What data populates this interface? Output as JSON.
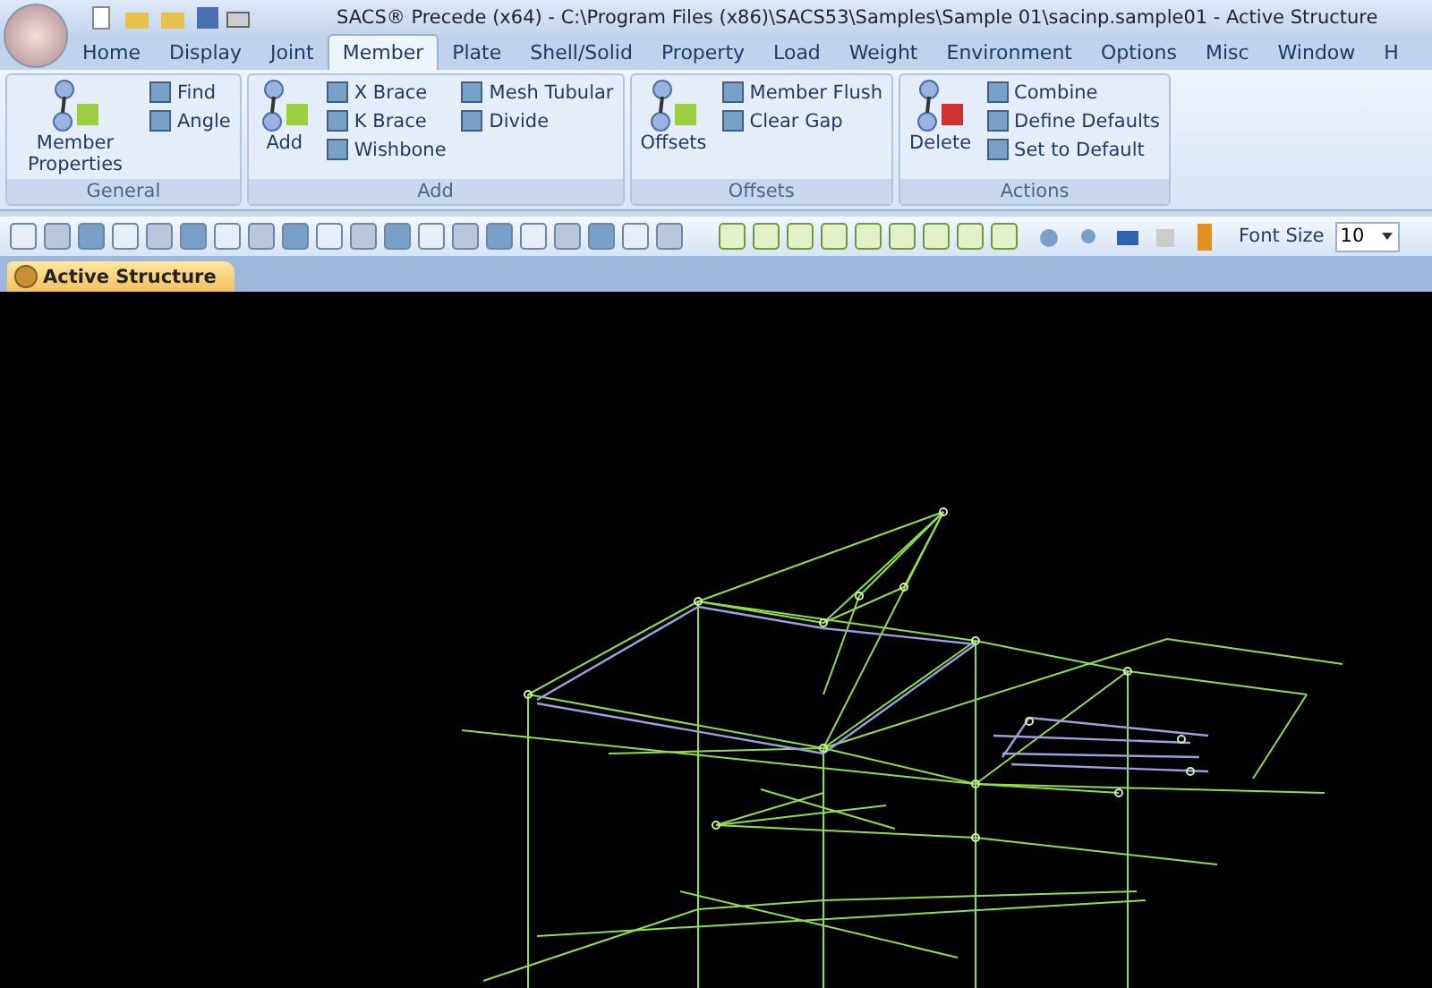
{
  "window": {
    "title": "SACS® Precede (x64) - C:\\Program Files (x86)\\SACS53\\Samples\\Sample 01\\sacinp.sample01 - Active Structure"
  },
  "tabs": [
    {
      "label": "Home",
      "selected": false
    },
    {
      "label": "Display",
      "selected": false
    },
    {
      "label": "Joint",
      "selected": false
    },
    {
      "label": "Member",
      "selected": true
    },
    {
      "label": "Plate",
      "selected": false
    },
    {
      "label": "Shell/Solid",
      "selected": false
    },
    {
      "label": "Property",
      "selected": false
    },
    {
      "label": "Load",
      "selected": false
    },
    {
      "label": "Weight",
      "selected": false
    },
    {
      "label": "Environment",
      "selected": false
    },
    {
      "label": "Options",
      "selected": false
    },
    {
      "label": "Misc",
      "selected": false
    },
    {
      "label": "Window",
      "selected": false
    },
    {
      "label": "H",
      "selected": false
    }
  ],
  "ribbon_groups": [
    {
      "label": "General",
      "columns": [
        [
          {
            "kind": "large",
            "label": "Member Properties"
          }
        ],
        [
          {
            "kind": "small",
            "label": "Find"
          },
          {
            "kind": "small",
            "label": "Angle"
          }
        ]
      ]
    },
    {
      "label": "Add",
      "columns": [
        [
          {
            "kind": "large",
            "label": "Add"
          }
        ],
        [
          {
            "kind": "small",
            "label": "X Brace"
          },
          {
            "kind": "small",
            "label": "K Brace"
          },
          {
            "kind": "small",
            "label": "Wishbone"
          }
        ],
        [
          {
            "kind": "small",
            "label": "Mesh Tubular"
          },
          {
            "kind": "small",
            "label": "Divide"
          }
        ]
      ]
    },
    {
      "label": "Offsets",
      "columns": [
        [
          {
            "kind": "large",
            "label": "Offsets"
          }
        ],
        [
          {
            "kind": "small",
            "label": "Member Flush"
          },
          {
            "kind": "small",
            "label": "Clear Gap"
          }
        ]
      ]
    },
    {
      "label": "Actions",
      "columns": [
        [
          {
            "kind": "large",
            "label": "Delete"
          }
        ],
        [
          {
            "kind": "small",
            "label": "Combine"
          },
          {
            "kind": "small",
            "label": "Define Defaults"
          },
          {
            "kind": "small",
            "label": "Set to Default"
          }
        ]
      ]
    }
  ],
  "toolbar": {
    "font_size": {
      "label": "Font Size",
      "value": "10"
    }
  },
  "document_tab": {
    "label": "Active Structure"
  }
}
